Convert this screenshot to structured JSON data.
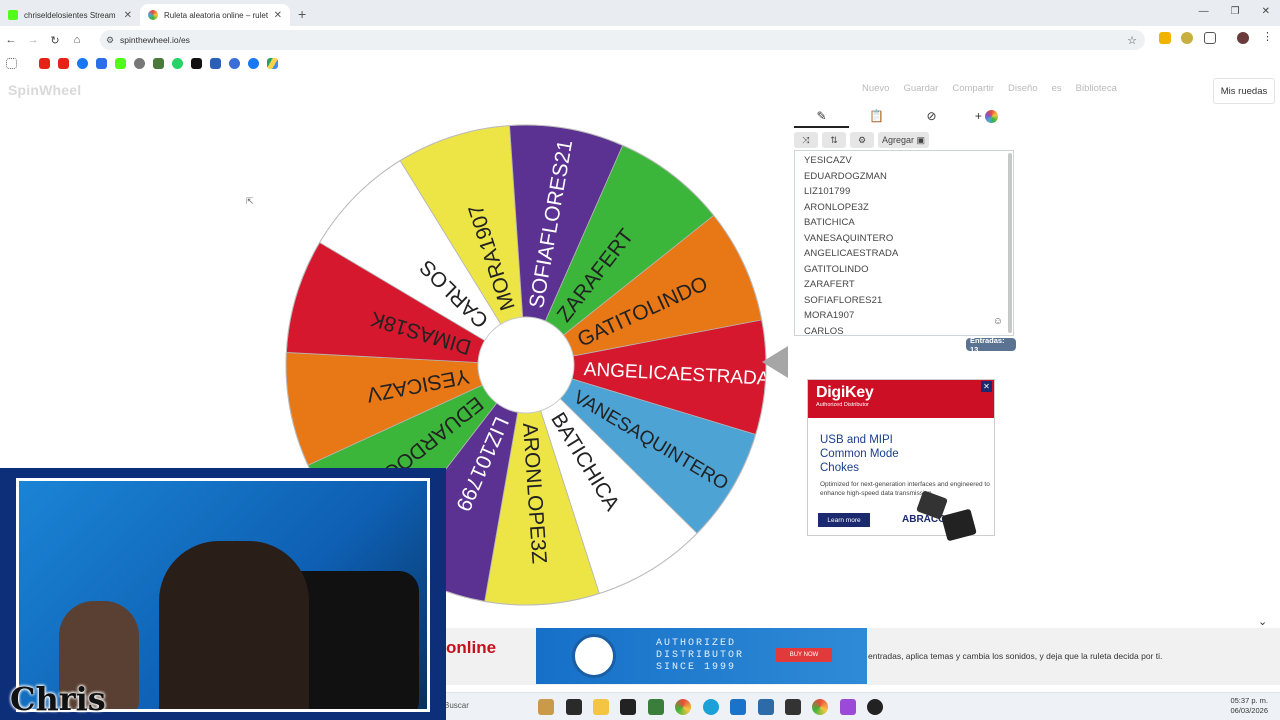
{
  "browser": {
    "tabs": [
      {
        "title": "chriseldelosientes Stream - Wa",
        "favicon_color": "#53fc18"
      },
      {
        "title": "Ruleta aleatoria online – ruleta",
        "favicon_color": "#e84a3c"
      }
    ],
    "url": "spinthewheel.io/es"
  },
  "site": {
    "logo": "SpinWheel",
    "menu": [
      "Nuevo",
      "Guardar",
      "Compartir",
      "Diseño",
      "es",
      "Biblioteca"
    ],
    "my_wheels": "Mis ruedas"
  },
  "wheel": {
    "segments": [
      {
        "label": "ANGELICAESTRADA",
        "color": "#d5182e",
        "text": "#ffffff"
      },
      {
        "label": "VANESAQUINTERO",
        "color": "#4da3d4",
        "text": "#222222"
      },
      {
        "label": "BATICHICA",
        "color": "#ffffff",
        "text": "#222222"
      },
      {
        "label": "ARONLOPE3Z",
        "color": "#ede545",
        "text": "#222222"
      },
      {
        "label": "LIZ101799",
        "color": "#5b3191",
        "text": "#ffffff"
      },
      {
        "label": "EDUARDOGZMAN",
        "color": "#3bb53a",
        "text": "#222222"
      },
      {
        "label": "YESICAZV",
        "color": "#e87716",
        "text": "#222222"
      },
      {
        "label": "DIMAS18K",
        "color": "#d5182e",
        "text": "#222222"
      },
      {
        "label": "CARLOS",
        "color": "#ffffff",
        "text": "#222222"
      },
      {
        "label": "MORA1907",
        "color": "#ede545",
        "text": "#222222"
      },
      {
        "label": "SOFIAFLORES21",
        "color": "#5b3191",
        "text": "#ffffff"
      },
      {
        "label": "ZARAFERT",
        "color": "#3bb53a",
        "text": "#222222"
      },
      {
        "label": "GATITOLINDO",
        "color": "#e87716",
        "text": "#222222"
      }
    ]
  },
  "panel": {
    "add_label": "Agregar",
    "entries": [
      "YESICAZV",
      "EDUARDOGZMAN",
      "LIZ101799",
      "ARONLOPE3Z",
      "BATICHICA",
      "VANESAQUINTERO",
      "ANGELICAESTRADA",
      "GATITOLINDO",
      "ZARAFERT",
      "SOFIAFLORES21",
      "MORA1907",
      "CARLOS"
    ],
    "count_label": "Entradas: 13"
  },
  "ad_digikey": {
    "brand": "DigiKey",
    "sub": "Authorized Distributor",
    "headline": "USB and MIPI Common Mode Chokes",
    "body": "Optimized for next-generation interfaces and engineered to enhance high-speed data transmission.",
    "cta": "Learn more",
    "partner": "ABRACON"
  },
  "ad_bottom": {
    "online": "online",
    "line1": "AUTHORIZED",
    "line2": "DISTRIBUTOR",
    "line3": "SINCE 1999",
    "buy": "BUY NOW"
  },
  "description": "entradas, aplica temas y cambia los sonidos, y deja que la ruleta decida por ti.",
  "taskbar": {
    "search": "Buscar",
    "time": "05:37 p. m.",
    "date": "06/03/2026"
  },
  "stream": {
    "name": "Chris"
  }
}
